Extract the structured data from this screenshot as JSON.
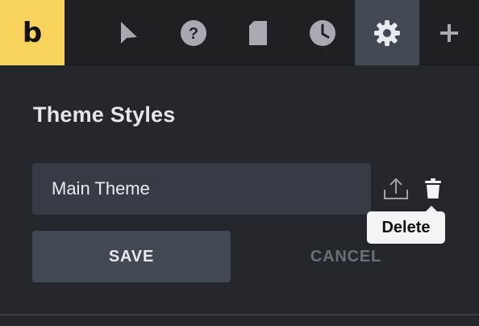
{
  "toolbar": {
    "logo_text": "b",
    "items": [
      {
        "icon": "pointer-icon",
        "active": false
      },
      {
        "icon": "help-icon",
        "active": false
      },
      {
        "icon": "document-icon",
        "active": false
      },
      {
        "icon": "clock-icon",
        "active": false
      },
      {
        "icon": "gear-icon",
        "active": true
      },
      {
        "icon": "plus-icon",
        "active": false
      }
    ]
  },
  "panel": {
    "title": "Theme Styles",
    "theme_name_value": "Main Theme",
    "export_icon": "upload-icon",
    "delete_icon": "trash-icon",
    "tooltip_text": "Delete",
    "save_label": "SAVE",
    "cancel_label": "CANCEL"
  },
  "colors": {
    "brand_yellow": "#f8d45c",
    "toolbar_bg": "#1e2023",
    "panel_bg": "#23262b",
    "active_tab_bg": "#424953",
    "input_bg": "#373c44",
    "muted_text": "#6b7078"
  }
}
